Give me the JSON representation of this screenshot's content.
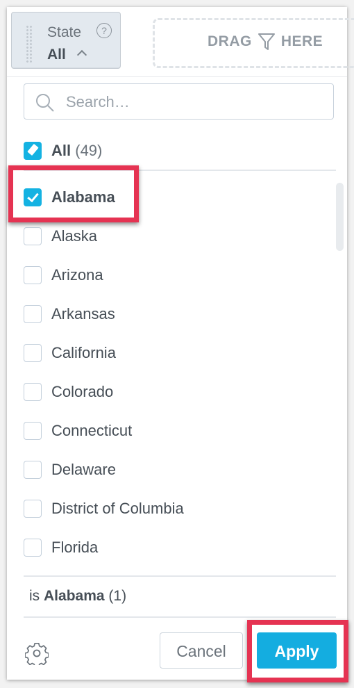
{
  "filter_chip": {
    "label": "State",
    "value": "All",
    "help_icon": "question-circle-icon",
    "chevron_icon": "chevron-up-icon"
  },
  "drop_zone": {
    "text_before": "DRAG",
    "icon": "funnel-icon",
    "text_after": "HERE"
  },
  "search": {
    "placeholder": "Search…",
    "value": ""
  },
  "select_all": {
    "label": "All",
    "count": "(49)",
    "state": "partial"
  },
  "items": [
    {
      "label": "Alabama",
      "checked": true
    },
    {
      "label": "Alaska",
      "checked": false
    },
    {
      "label": "Arizona",
      "checked": false
    },
    {
      "label": "Arkansas",
      "checked": false
    },
    {
      "label": "California",
      "checked": false
    },
    {
      "label": "Colorado",
      "checked": false
    },
    {
      "label": "Connecticut",
      "checked": false
    },
    {
      "label": "Delaware",
      "checked": false
    },
    {
      "label": "District of Columbia",
      "checked": false
    },
    {
      "label": "Florida",
      "checked": false
    }
  ],
  "summary": {
    "prefix": "is",
    "value": "Alabama",
    "count": "(1)"
  },
  "footer": {
    "settings_icon": "gear-icon",
    "cancel_label": "Cancel",
    "apply_label": "Apply"
  },
  "colors": {
    "accent": "#14b2e2",
    "highlight": "#e53352"
  }
}
